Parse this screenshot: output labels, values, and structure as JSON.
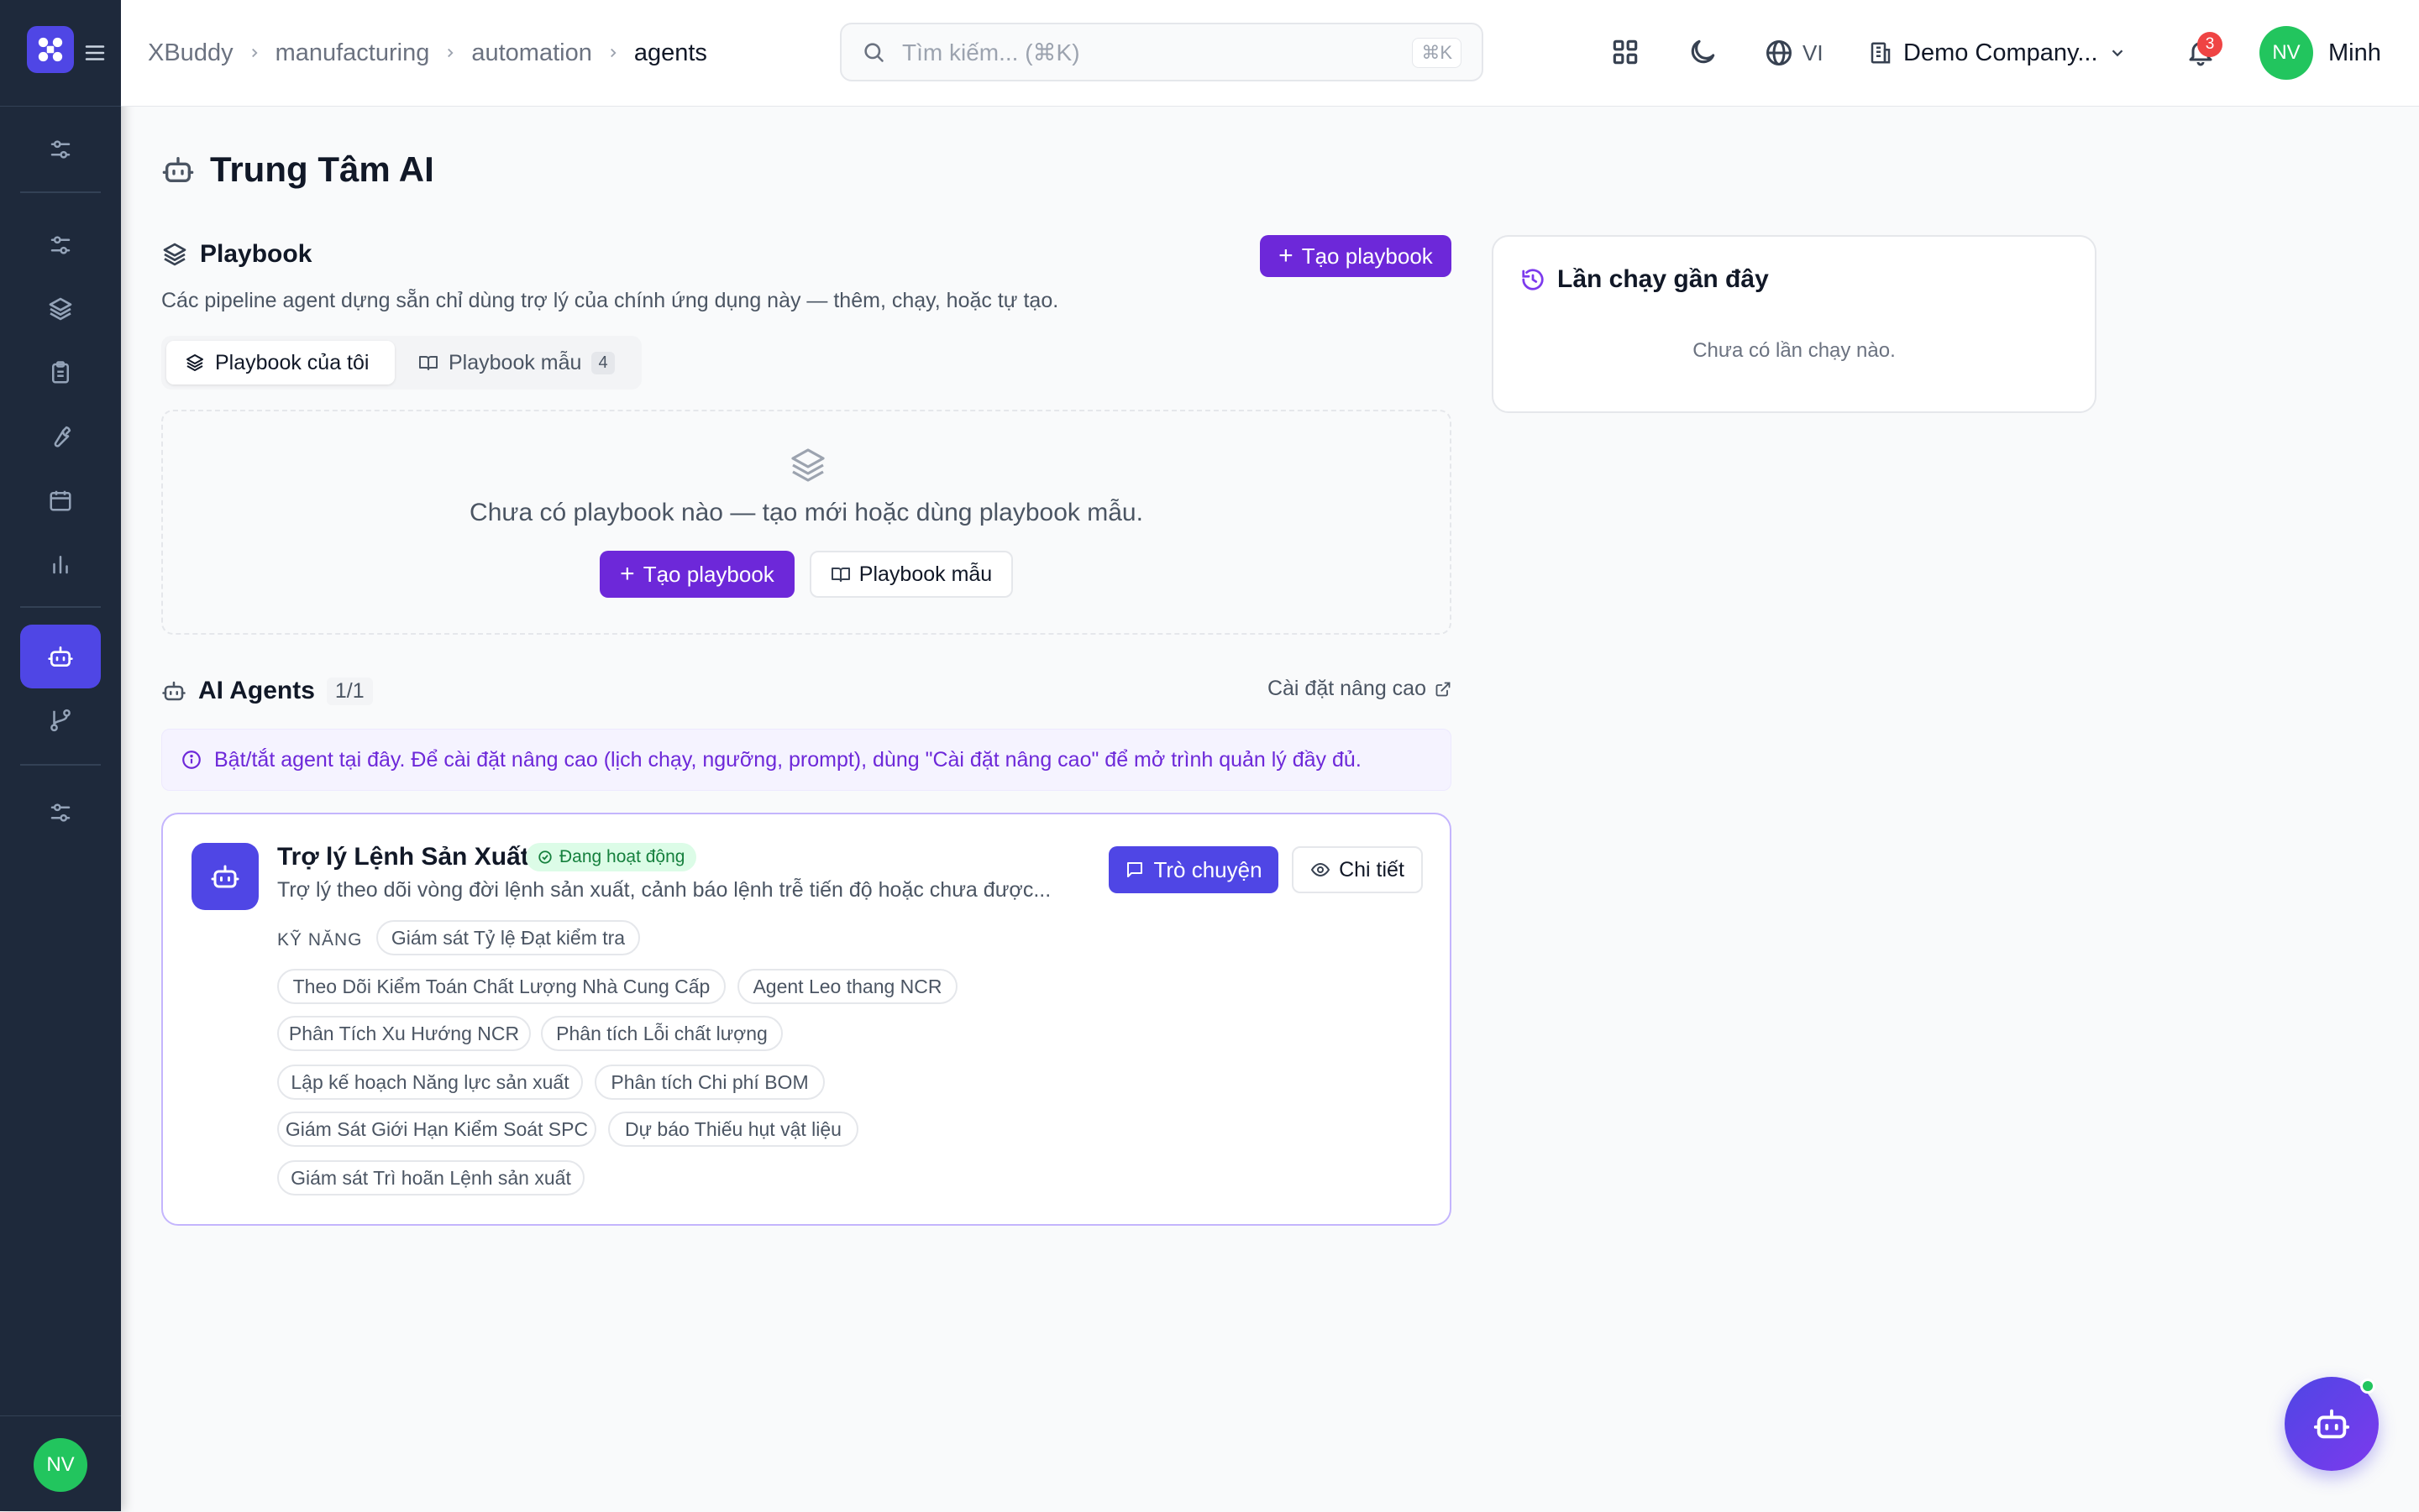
{
  "topbar": {
    "breadcrumbs": [
      "XBuddy",
      "manufacturing",
      "automation",
      "agents"
    ],
    "search_placeholder": "Tìm kiếm... (⌘K)",
    "search_shortcut": "⌘K",
    "language": "VI",
    "company": "Demo Company...",
    "notification_count": "3",
    "user_initials": "NV",
    "user_name": "Minh"
  },
  "sidebar": {
    "items": [
      "sliders-icon",
      "sliders-icon",
      "layers-icon",
      "clipboard-icon",
      "wrench-icon",
      "calendar-icon",
      "bar-chart-icon",
      "bot-icon",
      "git-branch-icon",
      "sliders-icon"
    ],
    "active_item": "bot-icon",
    "user_initials": "NV"
  },
  "page": {
    "title": "Trung Tâm AI"
  },
  "playbook": {
    "heading": "Playbook",
    "create_label": "Tạo playbook",
    "description": "Các pipeline agent dựng sẵn chỉ dùng trợ lý của chính ứng dụng này — thêm, chạy, hoặc tự tạo.",
    "tabs": [
      {
        "label": "Playbook của tôi",
        "active": true
      },
      {
        "label": "Playbook mẫu",
        "count": "4",
        "active": false
      }
    ],
    "empty_text": "Chưa có playbook nào — tạo mới hoặc dùng playbook mẫu.",
    "empty_create_label": "Tạo playbook",
    "empty_templates_label": "Playbook mẫu"
  },
  "agents": {
    "heading": "AI Agents",
    "count": "1/1",
    "advanced_link": "Cài đặt nâng cao",
    "info": "Bật/tắt agent tại đây. Để cài đặt nâng cao (lịch chạy, ngưỡng, prompt), dùng \"Cài đặt nâng cao\" để mở trình quản lý đầy đủ.",
    "list": [
      {
        "name": "Trợ lý Lệnh Sản Xuất",
        "status": "Đang hoạt động",
        "description": "Trợ lý theo dõi vòng đời lệnh sản xuất, cảnh báo lệnh trễ tiến độ hoặc chưa được...",
        "chat_label": "Trò chuyện",
        "detail_label": "Chi tiết",
        "skills_label": "KỸ NĂNG",
        "skills": [
          "Giám sát Tỷ lệ Đạt kiểm tra",
          "Theo Dõi Kiểm Toán Chất Lượng Nhà Cung Cấp",
          "Agent Leo thang NCR",
          "Phân Tích Xu Hướng NCR",
          "Phân tích Lỗi chất lượng",
          "Lập kế hoạch Năng lực sản xuất",
          "Phân tích Chi phí BOM",
          "Giám Sát Giới Hạn Kiểm Soát SPC",
          "Dự báo Thiếu hụt vật liệu",
          "Giám sát Trì hoãn Lệnh sản xuất"
        ]
      }
    ]
  },
  "recent_runs": {
    "title": "Lần chạy gần đây",
    "empty": "Chưa có lần chạy nào."
  },
  "colors": {
    "sidebar_bg": "#1e293b",
    "primary": "#6d28d9",
    "indigo": "#4f46e5",
    "success": "#22c55e",
    "danger": "#ef4444"
  }
}
